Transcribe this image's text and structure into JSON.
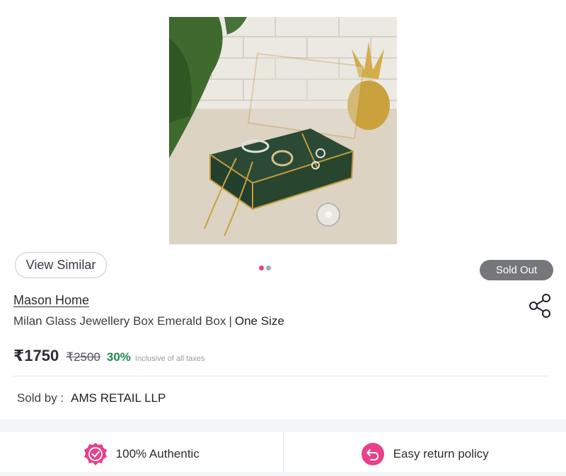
{
  "product": {
    "image_alt": "Milan Glass Jewellery Box Emerald Box",
    "brand": "Mason Home",
    "name": "Milan Glass Jewellery Box Emerald Box",
    "separator": "|",
    "size": "One Size",
    "status_badge": "Sold Out",
    "carousel": {
      "count": 2,
      "active_index": 0
    }
  },
  "actions": {
    "view_similar_label": "View Similar",
    "share_icon": "share-icon"
  },
  "pricing": {
    "price": "₹1750",
    "mrp": "₹2500",
    "discount": "30%",
    "tax_note": "Inclusive of all taxes"
  },
  "seller": {
    "label": "Sold by :",
    "name": "AMS RETAIL LLP"
  },
  "features": [
    {
      "icon": "authentic-badge-icon",
      "label": "100% Authentic"
    },
    {
      "icon": "return-arrow-icon",
      "label": "Easy return policy"
    }
  ],
  "colors": {
    "accent": "#e8408a",
    "discount": "#1f8a4c",
    "badge_bg": "#76777b"
  }
}
